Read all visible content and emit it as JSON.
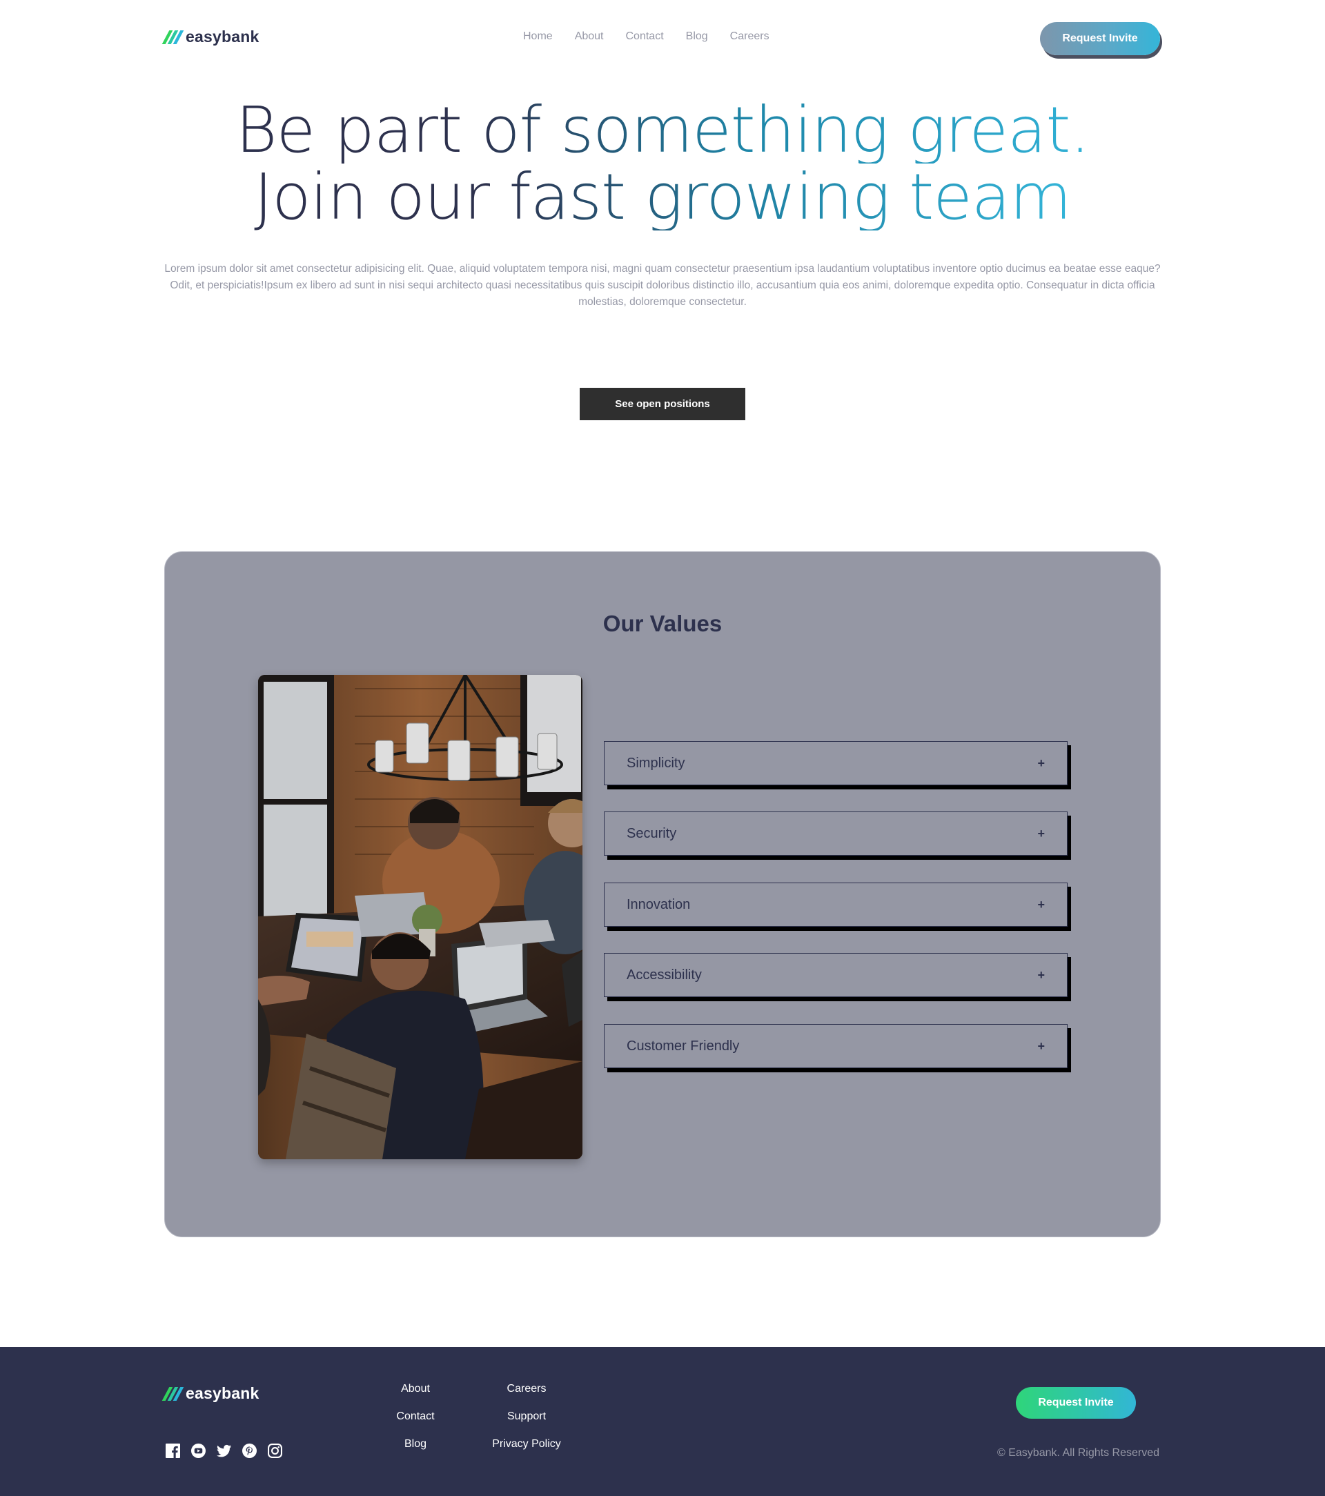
{
  "brand": {
    "name": "easybank",
    "icon": "easybank-logo-icon",
    "colors": {
      "navy": "#2d314d",
      "green": "#31d35c",
      "cyan": "#2bb7da",
      "grayish_blue": "#9698a6"
    }
  },
  "header": {
    "nav": [
      "Home",
      "About",
      "Contact",
      "Blog",
      "Careers"
    ],
    "cta_label": "Request Invite"
  },
  "hero": {
    "title_line1": "Be part of something great.",
    "title_line2": "Join our fast growing team",
    "text": "Lorem ipsum dolor sit amet consectetur adipisicing elit. Quae, aliquid voluptatem tempora nisi, magni quam consectetur praesentium ipsa laudantium voluptatibus inventore optio ducimus ea beatae esse eaque? Odit, et perspiciatis!Ipsum ex libero ad sunt in nisi sequi architecto quasi necessitatibus quis suscipit doloribus distinctio illo, accusantium quia eos animi, doloremque expedita optio. Consequatur in dicta officia molestias, doloremque consectetur.",
    "button_label": "See open positions"
  },
  "values": {
    "title": "Our Values",
    "photo_icon": "team-photo",
    "items": [
      {
        "label": "Simplicity",
        "toggle": "+"
      },
      {
        "label": "Security",
        "toggle": "+"
      },
      {
        "label": "Innovation",
        "toggle": "+"
      },
      {
        "label": "Accessibility",
        "toggle": "+"
      },
      {
        "label": "Customer Friendly",
        "toggle": "+"
      }
    ]
  },
  "footer": {
    "links_col1": [
      "About",
      "Contact",
      "Blog"
    ],
    "links_col2": [
      "Careers",
      "Support",
      "Privacy Policy"
    ],
    "social_icons": [
      "facebook-icon",
      "youtube-icon",
      "twitter-icon",
      "pinterest-icon",
      "instagram-icon"
    ],
    "cta_label": "Request Invite",
    "copyright": "© Easybank. All Rights Reserved"
  }
}
